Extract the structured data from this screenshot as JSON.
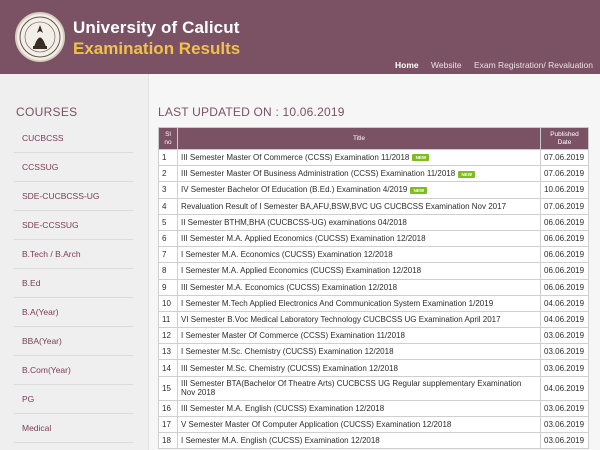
{
  "header": {
    "university": "University of Calicut",
    "subtitle": "Examination Results",
    "nav": [
      "Home",
      "Website",
      "Exam Registration/ Revaluation"
    ]
  },
  "sidebar": {
    "title": "COURSES",
    "items": [
      "CUCBCSS",
      "CCSSUG",
      "SDE-CUCBCSS-UG",
      "SDE-CCSSUG",
      "B.Tech / B.Arch",
      "B.Ed",
      "B.A(Year)",
      "BBA(Year)",
      "B.Com(Year)",
      "PG",
      "Medical"
    ]
  },
  "main": {
    "last_updated": "LAST UPDATED ON : 10.06.2019",
    "table": {
      "headers": {
        "sl": "Sl\nno",
        "title": "Title",
        "date": "Published\nDate"
      },
      "rows": [
        {
          "no": "1",
          "title": "III Semester Master Of Commerce (CCSS) Examination 11/2018",
          "date": "07.06.2019",
          "new": true
        },
        {
          "no": "2",
          "title": "III Semester Master Of Business Administration (CCSS) Examination 11/2018",
          "date": "07.06.2019",
          "new": true
        },
        {
          "no": "3",
          "title": "IV Semester Bachelor Of Education (B.Ed.) Examination 4/2019",
          "date": "10.06.2019",
          "new": true
        },
        {
          "no": "4",
          "title": "Revaluation Result of I Semester BA,AFU,BSW,BVC UG CUCBCSS Examination Nov 2017",
          "date": "07.06.2019"
        },
        {
          "no": "5",
          "title": "II Semester BTHM,BHA (CUCBCSS-UG) examinations 04/2018",
          "date": "06.06.2019"
        },
        {
          "no": "6",
          "title": "III Semester M.A. Applied Economics (CUCSS) Examination 12/2018",
          "date": "06.06.2019"
        },
        {
          "no": "7",
          "title": "I Semester M.A. Economics (CUCSS) Examination 12/2018",
          "date": "06.06.2019"
        },
        {
          "no": "8",
          "title": "I Semester M.A. Applied Economics (CUCSS) Examination 12/2018",
          "date": "06.06.2019"
        },
        {
          "no": "9",
          "title": "III Semester M.A. Economics (CUCSS) Examination 12/2018",
          "date": "06.06.2019"
        },
        {
          "no": "10",
          "title": "I Semester M.Tech Applied Electronics And Communication System Examination 1/2019",
          "date": "04.06.2019"
        },
        {
          "no": "11",
          "title": "VI Semester B.Voc Medical Laboratory Technology CUCBCSS UG Examination April 2017",
          "date": "04.06.2019"
        },
        {
          "no": "12",
          "title": "I Semester Master Of Commerce (CCSS) Examination 11/2018",
          "date": "03.06.2019"
        },
        {
          "no": "13",
          "title": "I Semester M.Sc. Chemistry (CUCSS) Examination 12/2018",
          "date": "03.06.2019"
        },
        {
          "no": "14",
          "title": "III Semester M.Sc. Chemistry (CUCSS) Examination 12/2018",
          "date": "03.06.2019"
        },
        {
          "no": "15",
          "title": "III Semester BTA(Bachelor Of Theatre Arts) CUCBCSS UG Regular supplementary Examination Nov 2018",
          "date": "04.06.2019"
        },
        {
          "no": "16",
          "title": "III Semester M.A. English (CUCSS) Examination 12/2018",
          "date": "03.06.2019"
        },
        {
          "no": "17",
          "title": "V Semester Master Of Computer Application (CUCSS) Examination 12/2018",
          "date": "03.06.2019"
        },
        {
          "no": "18",
          "title": "I Semester M.A. English (CUCSS) Examination 12/2018",
          "date": "03.06.2019"
        }
      ]
    },
    "new_badge": "NEW"
  }
}
